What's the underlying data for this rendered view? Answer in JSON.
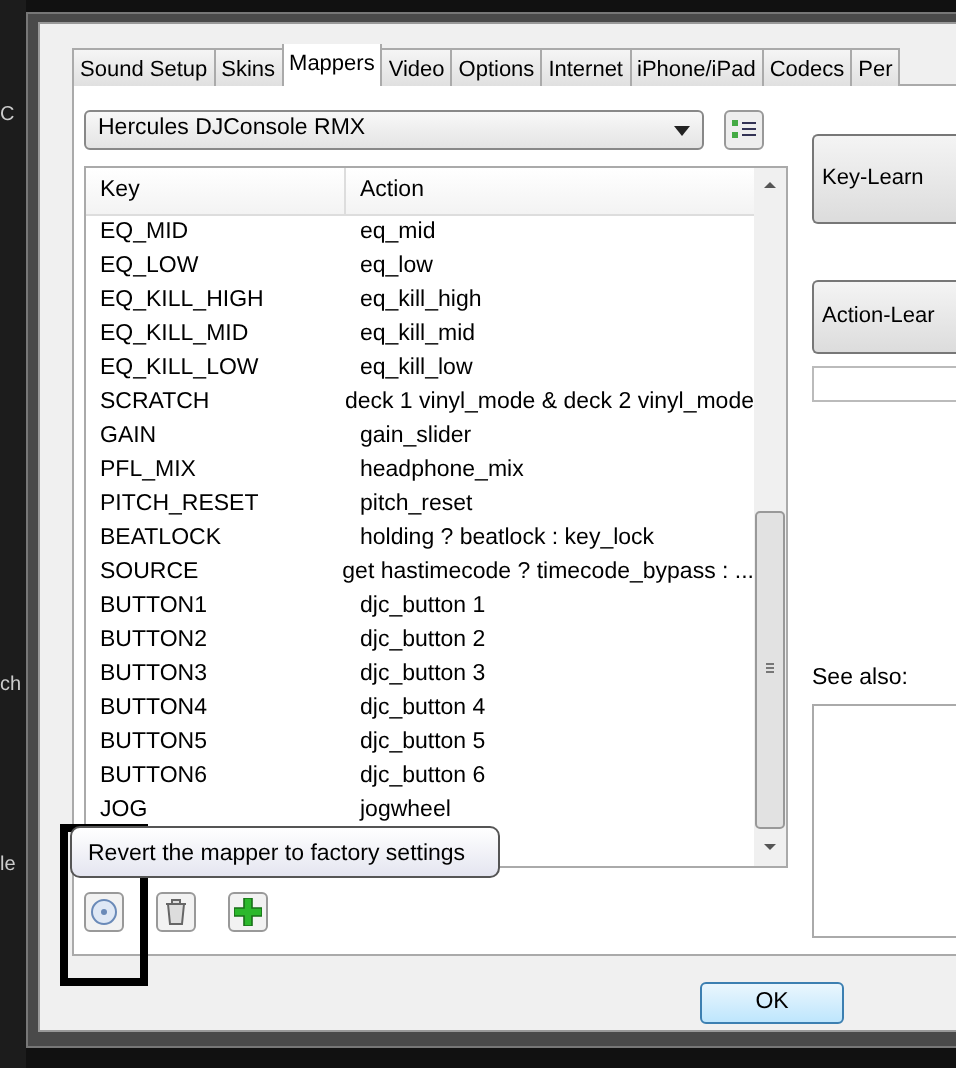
{
  "background_fragments": [
    "C",
    "ch",
    "le"
  ],
  "tabs": [
    {
      "label": "Sound Setup",
      "selected": false
    },
    {
      "label": "Skins",
      "selected": false
    },
    {
      "label": "Mappers",
      "selected": true
    },
    {
      "label": "Video",
      "selected": false
    },
    {
      "label": "Options",
      "selected": false
    },
    {
      "label": "Internet",
      "selected": false
    },
    {
      "label": "iPhone/iPad",
      "selected": false
    },
    {
      "label": "Codecs",
      "selected": false
    },
    {
      "label": "Per",
      "selected": false
    }
  ],
  "mapper_dropdown": {
    "value": "Hercules DJConsole RMX"
  },
  "table": {
    "columns": [
      "Key",
      "Action"
    ],
    "rows": [
      [
        "EQ_MID",
        "eq_mid"
      ],
      [
        "EQ_LOW",
        "eq_low"
      ],
      [
        "EQ_KILL_HIGH",
        "eq_kill_high"
      ],
      [
        "EQ_KILL_MID",
        "eq_kill_mid"
      ],
      [
        "EQ_KILL_LOW",
        "eq_kill_low"
      ],
      [
        "SCRATCH",
        "deck 1 vinyl_mode & deck 2 vinyl_mode"
      ],
      [
        "GAIN",
        "gain_slider"
      ],
      [
        "PFL_MIX",
        "headphone_mix"
      ],
      [
        "PITCH_RESET",
        "pitch_reset"
      ],
      [
        "BEATLOCK",
        "holding ? beatlock : key_lock"
      ],
      [
        "SOURCE",
        "get hastimecode ? timecode_bypass : ..."
      ],
      [
        "BUTTON1",
        "djc_button 1"
      ],
      [
        "BUTTON2",
        "djc_button 2"
      ],
      [
        "BUTTON3",
        "djc_button 3"
      ],
      [
        "BUTTON4",
        "djc_button 4"
      ],
      [
        "BUTTON5",
        "djc_button 5"
      ],
      [
        "BUTTON6",
        "djc_button 6"
      ],
      [
        "JOG",
        "jogwheel"
      ]
    ]
  },
  "side": {
    "key_learn": "Key-Learn",
    "action_learn": "Action-Lear",
    "see_also": "See also:"
  },
  "tooltip": "Revert the mapper to factory settings",
  "ok_button": "OK"
}
